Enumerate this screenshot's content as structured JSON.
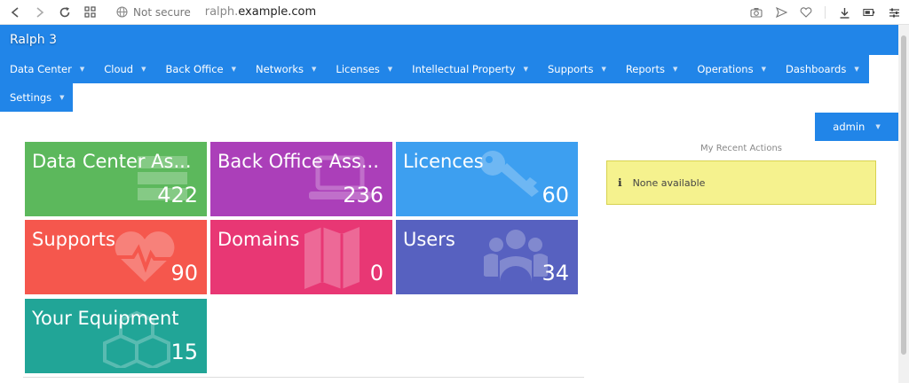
{
  "browser": {
    "security": "Not secure",
    "url_prefix": "ralph.",
    "url_domain": "example.com"
  },
  "app": {
    "title": "Ralph 3"
  },
  "menu": {
    "row1": [
      {
        "label": "Data Center"
      },
      {
        "label": "Cloud"
      },
      {
        "label": "Back Office"
      },
      {
        "label": "Networks"
      },
      {
        "label": "Licenses"
      },
      {
        "label": "Intellectual Property"
      },
      {
        "label": "Supports"
      },
      {
        "label": "Reports"
      },
      {
        "label": "Operations"
      },
      {
        "label": "Dashboards"
      }
    ],
    "row2": [
      {
        "label": "Settings"
      }
    ]
  },
  "user": {
    "name": "admin"
  },
  "tiles": [
    {
      "title": "Data Center As...",
      "count": "422",
      "color": "#5cb85c",
      "icon": "server-icon"
    },
    {
      "title": "Back Office Ass...",
      "count": "236",
      "color": "#ab3fb9",
      "icon": "laptop-icon"
    },
    {
      "title": "Licences",
      "count": "60",
      "color": "#3d9ff0",
      "icon": "key-icon"
    },
    {
      "title": "Supports",
      "count": "90",
      "color": "#f5574d",
      "icon": "heartbeat-icon"
    },
    {
      "title": "Domains",
      "count": "0",
      "color": "#e83774",
      "icon": "map-icon"
    },
    {
      "title": "Users",
      "count": "34",
      "color": "#5761c0",
      "icon": "users-icon"
    },
    {
      "title": "Your Equipment",
      "count": "15",
      "color": "#21a597",
      "icon": "cubes-icon"
    }
  ],
  "recent": {
    "title": "My Recent Actions",
    "empty": "None available"
  },
  "colors": {
    "primary": "#2185e8",
    "notice_bg": "#f5f28e"
  }
}
